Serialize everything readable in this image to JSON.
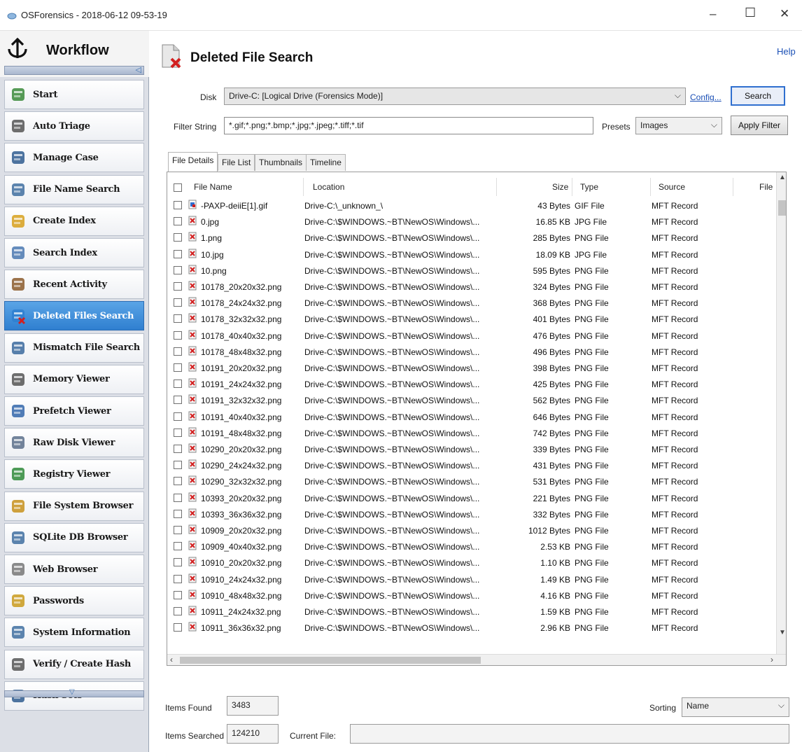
{
  "window": {
    "title": "OSForensics - 2018-06-12 09-53-19",
    "minimize": "–",
    "maximize": "☐",
    "close": "✕"
  },
  "sidebar": {
    "header": "Workflow",
    "collapse_arrow": "◁",
    "scroll_down_arrow": "▽",
    "items": [
      {
        "label": "Start",
        "icon": "start-icon",
        "active": false
      },
      {
        "label": "Auto Triage",
        "icon": "auto-triage-icon",
        "active": false
      },
      {
        "label": "Manage Case",
        "icon": "manage-case-icon",
        "active": false
      },
      {
        "label": "File Name Search",
        "icon": "file-name-search-icon",
        "active": false
      },
      {
        "label": "Create Index",
        "icon": "create-index-icon",
        "active": false
      },
      {
        "label": "Search Index",
        "icon": "search-index-icon",
        "active": false
      },
      {
        "label": "Recent Activity",
        "icon": "recent-activity-icon",
        "active": false
      },
      {
        "label": "Deleted Files Search",
        "icon": "deleted-files-search-icon",
        "active": true
      },
      {
        "label": "Mismatch File Search",
        "icon": "mismatch-file-search-icon",
        "active": false
      },
      {
        "label": "Memory Viewer",
        "icon": "memory-viewer-icon",
        "active": false
      },
      {
        "label": "Prefetch Viewer",
        "icon": "prefetch-viewer-icon",
        "active": false
      },
      {
        "label": "Raw Disk Viewer",
        "icon": "raw-disk-viewer-icon",
        "active": false
      },
      {
        "label": "Registry Viewer",
        "icon": "registry-viewer-icon",
        "active": false
      },
      {
        "label": "File System Browser",
        "icon": "file-system-browser-icon",
        "active": false
      },
      {
        "label": "SQLite DB Browser",
        "icon": "sqlite-db-browser-icon",
        "active": false
      },
      {
        "label": "Web Browser",
        "icon": "web-browser-icon",
        "active": false
      },
      {
        "label": "Passwords",
        "icon": "passwords-icon",
        "active": false
      },
      {
        "label": "System Information",
        "icon": "system-information-icon",
        "active": false
      },
      {
        "label": "Verify / Create Hash",
        "icon": "verify-create-hash-icon",
        "active": false
      },
      {
        "label": "Hash Sets",
        "icon": "hash-sets-icon",
        "active": false
      }
    ]
  },
  "panel": {
    "title": "Deleted File Search",
    "help": "Help",
    "disk_label": "Disk",
    "disk_value": "Drive-C: [Logical Drive (Forensics Mode)]",
    "config_link": "Config...",
    "search_button": "Search",
    "filter_label": "Filter String",
    "filter_value": "*.gif;*.png;*.bmp;*.jpg;*.jpeg;*.tiff;*.tif",
    "presets_label": "Presets",
    "presets_value": "Images",
    "apply_filter_button": "Apply Filter",
    "dropdown_arrow": "⌵"
  },
  "tabs": [
    "File Details",
    "File List",
    "Thumbnails",
    "Timeline"
  ],
  "table": {
    "columns": [
      "File Name",
      "Location",
      "Size",
      "Type",
      "Source",
      "File"
    ],
    "rows": [
      {
        "name": "-PAXP-deiiE[1].gif",
        "location": "Drive-C:\\_unknown_\\",
        "size": "43 Bytes",
        "type": "GIF File",
        "source": "MFT Record",
        "icon": "gif"
      },
      {
        "name": "0.jpg",
        "location": "Drive-C:\\$WINDOWS.~BT\\NewOS\\Windows\\...",
        "size": "16.85 KB",
        "type": "JPG File",
        "source": "MFT Record",
        "icon": "deleted"
      },
      {
        "name": "1.png",
        "location": "Drive-C:\\$WINDOWS.~BT\\NewOS\\Windows\\...",
        "size": "285 Bytes",
        "type": "PNG File",
        "source": "MFT Record",
        "icon": "deleted"
      },
      {
        "name": "10.jpg",
        "location": "Drive-C:\\$WINDOWS.~BT\\NewOS\\Windows\\...",
        "size": "18.09 KB",
        "type": "JPG File",
        "source": "MFT Record",
        "icon": "deleted"
      },
      {
        "name": "10.png",
        "location": "Drive-C:\\$WINDOWS.~BT\\NewOS\\Windows\\...",
        "size": "595 Bytes",
        "type": "PNG File",
        "source": "MFT Record",
        "icon": "deleted"
      },
      {
        "name": "10178_20x20x32.png",
        "location": "Drive-C:\\$WINDOWS.~BT\\NewOS\\Windows\\...",
        "size": "324 Bytes",
        "type": "PNG File",
        "source": "MFT Record",
        "icon": "deleted"
      },
      {
        "name": "10178_24x24x32.png",
        "location": "Drive-C:\\$WINDOWS.~BT\\NewOS\\Windows\\...",
        "size": "368 Bytes",
        "type": "PNG File",
        "source": "MFT Record",
        "icon": "deleted"
      },
      {
        "name": "10178_32x32x32.png",
        "location": "Drive-C:\\$WINDOWS.~BT\\NewOS\\Windows\\...",
        "size": "401 Bytes",
        "type": "PNG File",
        "source": "MFT Record",
        "icon": "deleted"
      },
      {
        "name": "10178_40x40x32.png",
        "location": "Drive-C:\\$WINDOWS.~BT\\NewOS\\Windows\\...",
        "size": "476 Bytes",
        "type": "PNG File",
        "source": "MFT Record",
        "icon": "deleted"
      },
      {
        "name": "10178_48x48x32.png",
        "location": "Drive-C:\\$WINDOWS.~BT\\NewOS\\Windows\\...",
        "size": "496 Bytes",
        "type": "PNG File",
        "source": "MFT Record",
        "icon": "deleted"
      },
      {
        "name": "10191_20x20x32.png",
        "location": "Drive-C:\\$WINDOWS.~BT\\NewOS\\Windows\\...",
        "size": "398 Bytes",
        "type": "PNG File",
        "source": "MFT Record",
        "icon": "deleted"
      },
      {
        "name": "10191_24x24x32.png",
        "location": "Drive-C:\\$WINDOWS.~BT\\NewOS\\Windows\\...",
        "size": "425 Bytes",
        "type": "PNG File",
        "source": "MFT Record",
        "icon": "deleted"
      },
      {
        "name": "10191_32x32x32.png",
        "location": "Drive-C:\\$WINDOWS.~BT\\NewOS\\Windows\\...",
        "size": "562 Bytes",
        "type": "PNG File",
        "source": "MFT Record",
        "icon": "deleted"
      },
      {
        "name": "10191_40x40x32.png",
        "location": "Drive-C:\\$WINDOWS.~BT\\NewOS\\Windows\\...",
        "size": "646 Bytes",
        "type": "PNG File",
        "source": "MFT Record",
        "icon": "deleted"
      },
      {
        "name": "10191_48x48x32.png",
        "location": "Drive-C:\\$WINDOWS.~BT\\NewOS\\Windows\\...",
        "size": "742 Bytes",
        "type": "PNG File",
        "source": "MFT Record",
        "icon": "deleted"
      },
      {
        "name": "10290_20x20x32.png",
        "location": "Drive-C:\\$WINDOWS.~BT\\NewOS\\Windows\\...",
        "size": "339 Bytes",
        "type": "PNG File",
        "source": "MFT Record",
        "icon": "deleted"
      },
      {
        "name": "10290_24x24x32.png",
        "location": "Drive-C:\\$WINDOWS.~BT\\NewOS\\Windows\\...",
        "size": "431 Bytes",
        "type": "PNG File",
        "source": "MFT Record",
        "icon": "deleted"
      },
      {
        "name": "10290_32x32x32.png",
        "location": "Drive-C:\\$WINDOWS.~BT\\NewOS\\Windows\\...",
        "size": "531 Bytes",
        "type": "PNG File",
        "source": "MFT Record",
        "icon": "deleted"
      },
      {
        "name": "10393_20x20x32.png",
        "location": "Drive-C:\\$WINDOWS.~BT\\NewOS\\Windows\\...",
        "size": "221 Bytes",
        "type": "PNG File",
        "source": "MFT Record",
        "icon": "deleted"
      },
      {
        "name": "10393_36x36x32.png",
        "location": "Drive-C:\\$WINDOWS.~BT\\NewOS\\Windows\\...",
        "size": "332 Bytes",
        "type": "PNG File",
        "source": "MFT Record",
        "icon": "deleted"
      },
      {
        "name": "10909_20x20x32.png",
        "location": "Drive-C:\\$WINDOWS.~BT\\NewOS\\Windows\\...",
        "size": "1012 Bytes",
        "type": "PNG File",
        "source": "MFT Record",
        "icon": "deleted"
      },
      {
        "name": "10909_40x40x32.png",
        "location": "Drive-C:\\$WINDOWS.~BT\\NewOS\\Windows\\...",
        "size": "2.53 KB",
        "type": "PNG File",
        "source": "MFT Record",
        "icon": "deleted"
      },
      {
        "name": "10910_20x20x32.png",
        "location": "Drive-C:\\$WINDOWS.~BT\\NewOS\\Windows\\...",
        "size": "1.10 KB",
        "type": "PNG File",
        "source": "MFT Record",
        "icon": "deleted"
      },
      {
        "name": "10910_24x24x32.png",
        "location": "Drive-C:\\$WINDOWS.~BT\\NewOS\\Windows\\...",
        "size": "1.49 KB",
        "type": "PNG File",
        "source": "MFT Record",
        "icon": "deleted"
      },
      {
        "name": "10910_48x48x32.png",
        "location": "Drive-C:\\$WINDOWS.~BT\\NewOS\\Windows\\...",
        "size": "4.16 KB",
        "type": "PNG File",
        "source": "MFT Record",
        "icon": "deleted"
      },
      {
        "name": "10911_24x24x32.png",
        "location": "Drive-C:\\$WINDOWS.~BT\\NewOS\\Windows\\...",
        "size": "1.59 KB",
        "type": "PNG File",
        "source": "MFT Record",
        "icon": "deleted"
      },
      {
        "name": "10911_36x36x32.png",
        "location": "Drive-C:\\$WINDOWS.~BT\\NewOS\\Windows\\...",
        "size": "2.96 KB",
        "type": "PNG File",
        "source": "MFT Record",
        "icon": "deleted"
      }
    ]
  },
  "footer": {
    "items_found_label": "Items Found",
    "items_found_value": "3483",
    "items_searched_label": "Items Searched",
    "items_searched_value": "124210",
    "current_file_label": "Current File:",
    "current_file_value": "",
    "sorting_label": "Sorting",
    "sorting_value": "Name"
  },
  "colors": {
    "active_item": "#2f7fd0",
    "link": "#1a4fb5",
    "deleted_mark": "#d21f1f"
  }
}
